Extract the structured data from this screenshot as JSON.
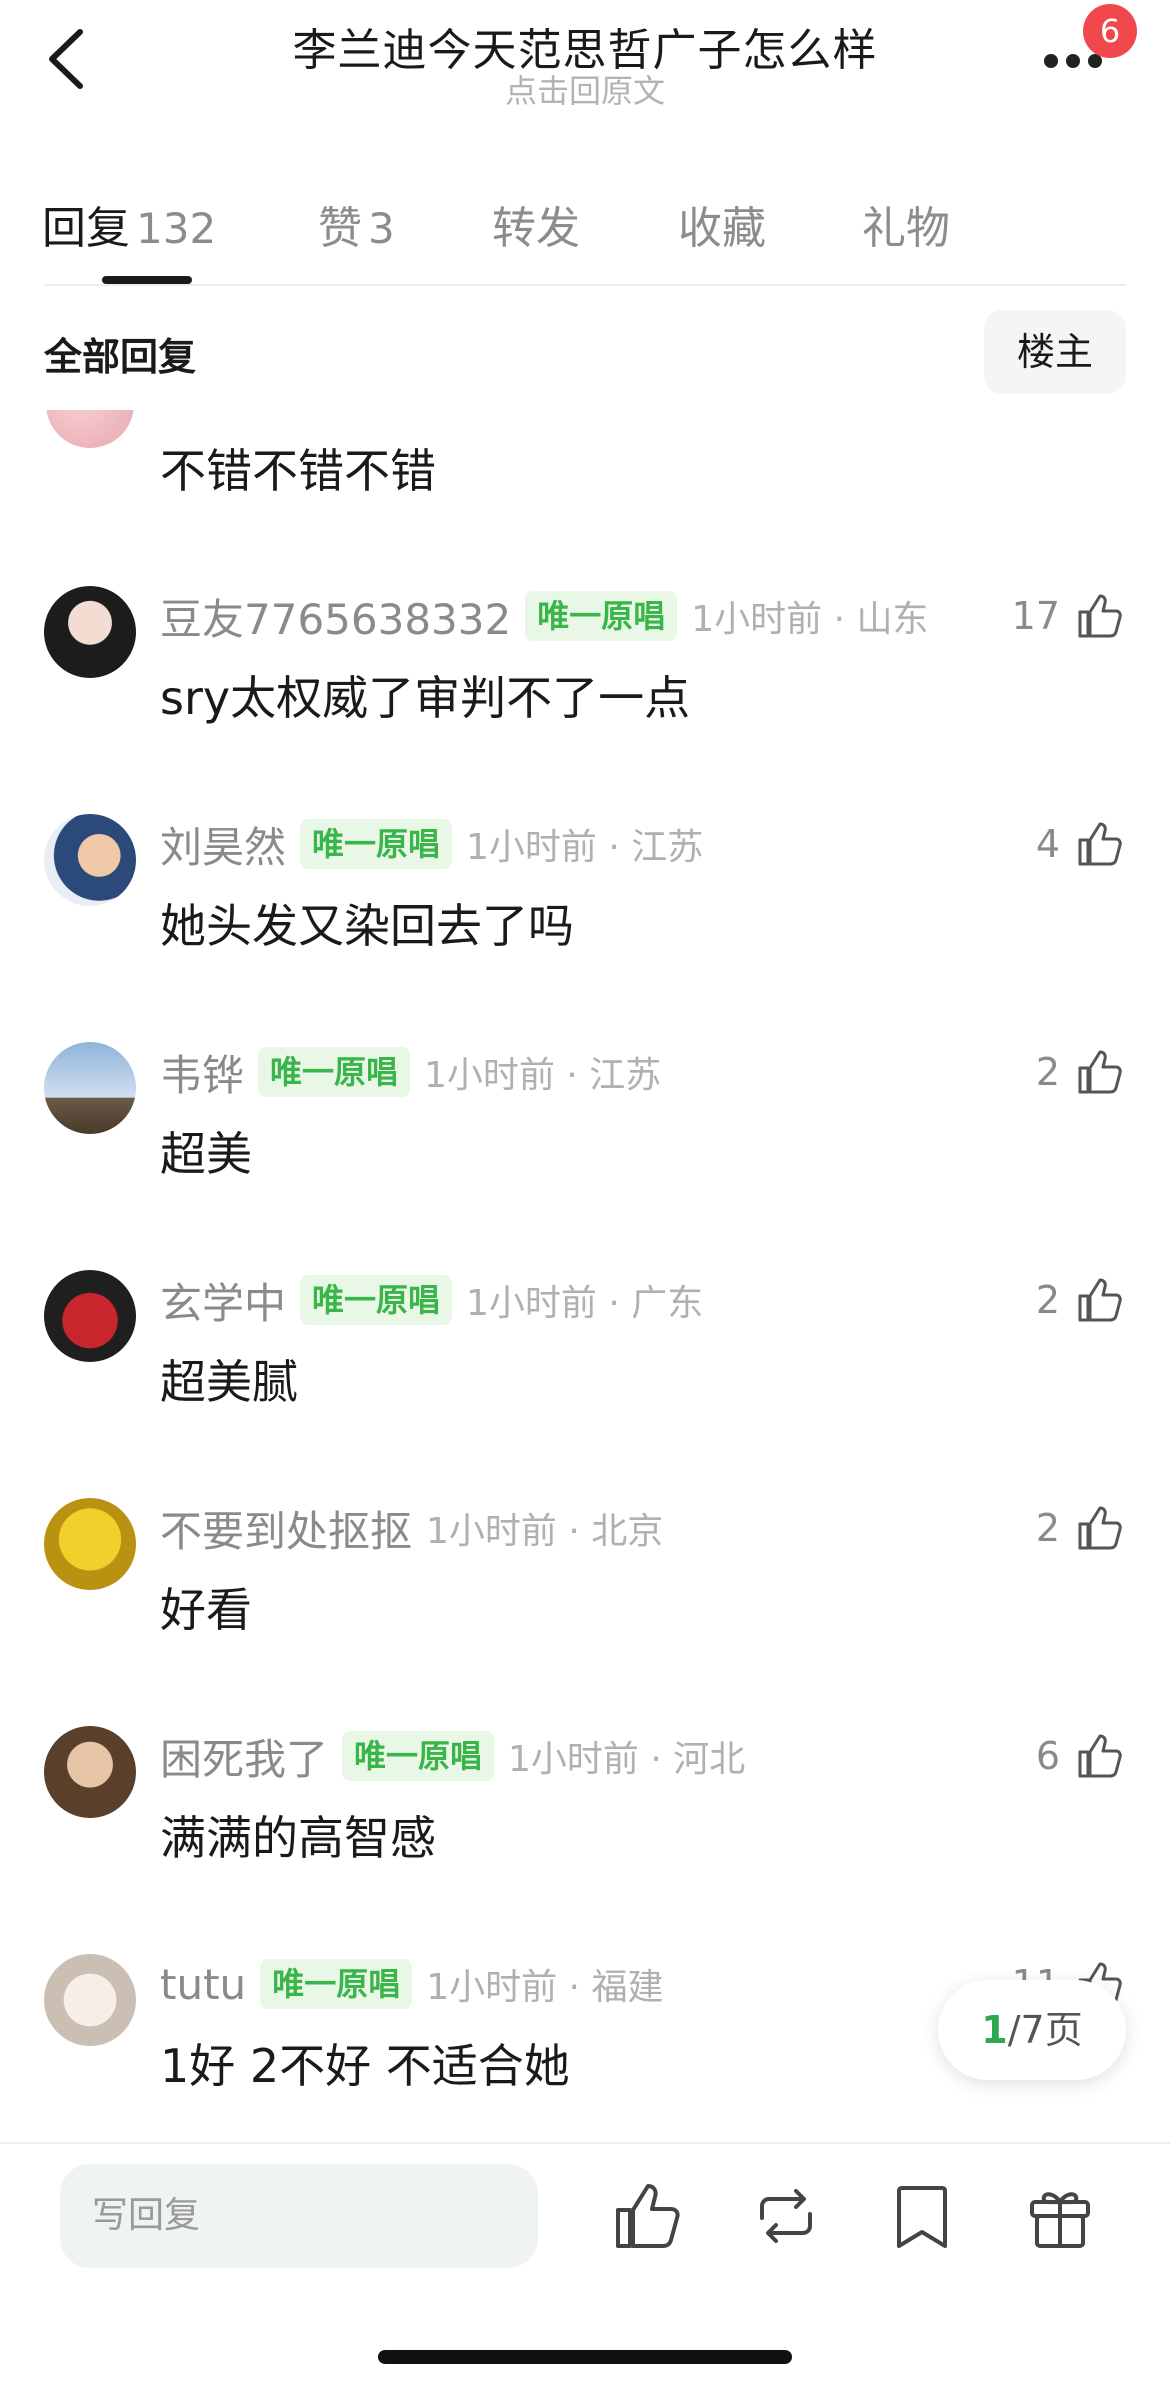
{
  "header": {
    "title": "李兰迪今天范思哲广子怎么样",
    "subtitle": "点击回原文",
    "badge_count": "6",
    "back_icon": "chevron-left-icon",
    "more_icon": "more-dots-icon"
  },
  "tabs": [
    {
      "label": "回复",
      "count": "132",
      "active": true
    },
    {
      "label": "赞",
      "count": "3",
      "active": false
    },
    {
      "label": "转发",
      "count": "",
      "active": false
    },
    {
      "label": "收藏",
      "count": "",
      "active": false
    },
    {
      "label": "礼物",
      "count": "",
      "active": false
    }
  ],
  "filter": {
    "label": "全部回复",
    "owner_button": "楼主"
  },
  "partial_comment": {
    "text": "不错不错不错"
  },
  "comments": [
    {
      "user": "豆友7765638332",
      "tag": "唯一原唱",
      "time": "1小时前 · 山东",
      "text": "sry太权威了审判不了一点",
      "likes": "17"
    },
    {
      "user": "刘昊然",
      "tag": "唯一原唱",
      "time": "1小时前 · 江苏",
      "text": "她头发又染回去了吗",
      "likes": "4"
    },
    {
      "user": "韦铧",
      "tag": "唯一原唱",
      "time": "1小时前 · 江苏",
      "text": "超美",
      "likes": "2"
    },
    {
      "user": "玄学中",
      "tag": "唯一原唱",
      "time": "1小时前 · 广东",
      "text": "超美腻",
      "likes": "2"
    },
    {
      "user": "不要到处抠抠",
      "tag": "",
      "time": "1小时前 · 北京",
      "text": "好看",
      "likes": "2"
    },
    {
      "user": "困死我了",
      "tag": "唯一原唱",
      "time": "1小时前 · 河北",
      "text": "满满的高智感",
      "likes": "6"
    },
    {
      "user": "tutu",
      "tag": "唯一原唱",
      "time": "1小时前 · 福建",
      "text": "1好 2不好 不适合她",
      "likes": "11"
    }
  ],
  "pagination": {
    "current": "1",
    "rest": "/7页"
  },
  "bottom_bar": {
    "reply_placeholder": "写回复",
    "icons": [
      "thumb-up-icon",
      "repost-icon",
      "bookmark-icon",
      "gift-icon"
    ]
  },
  "colors": {
    "accent_green": "#39b54a",
    "tag_bg": "#e9f7e7",
    "badge_red": "#f0484c"
  }
}
